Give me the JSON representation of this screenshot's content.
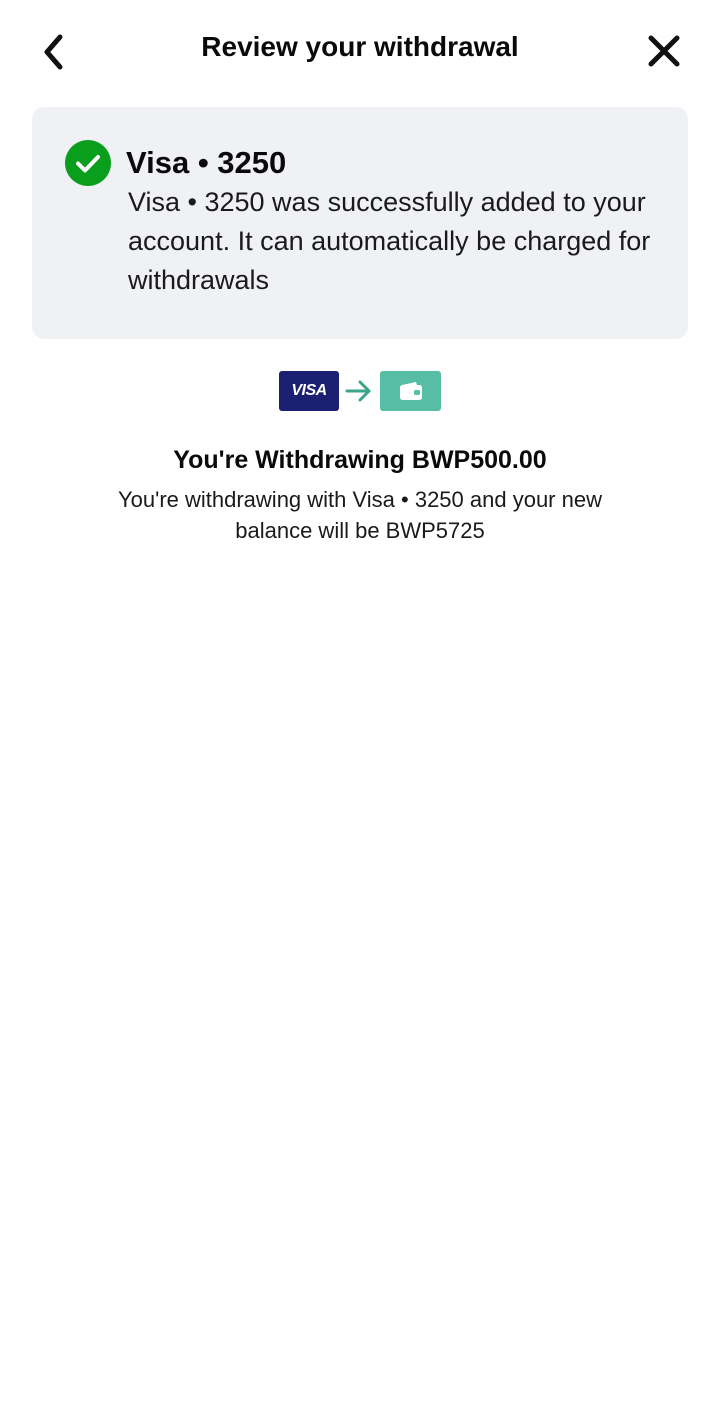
{
  "header": {
    "title": "Review your withdrawal",
    "back_icon": "chevron-left-icon",
    "close_icon": "close-icon"
  },
  "notice": {
    "icon": "check-circle-icon",
    "icon_color": "#0a9e1d",
    "background": "#f0f1f5",
    "title": "Visa • 3250",
    "message": "Visa • 3250 was successfully added to your account. It can automatically be charged for withdrawals"
  },
  "transfer_flow": {
    "source_label": "VISA",
    "source_color": "#1a1f71",
    "arrow_icon": "arrow-right-icon",
    "arrow_color": "#3aa589",
    "destination_icon": "wallet-icon",
    "destination_color": "#58bda5"
  },
  "summary": {
    "title": "You're Withdrawing BWP500.00",
    "message": "You're withdrawing with Visa • 3250 and your new balance will be BWP5725"
  }
}
